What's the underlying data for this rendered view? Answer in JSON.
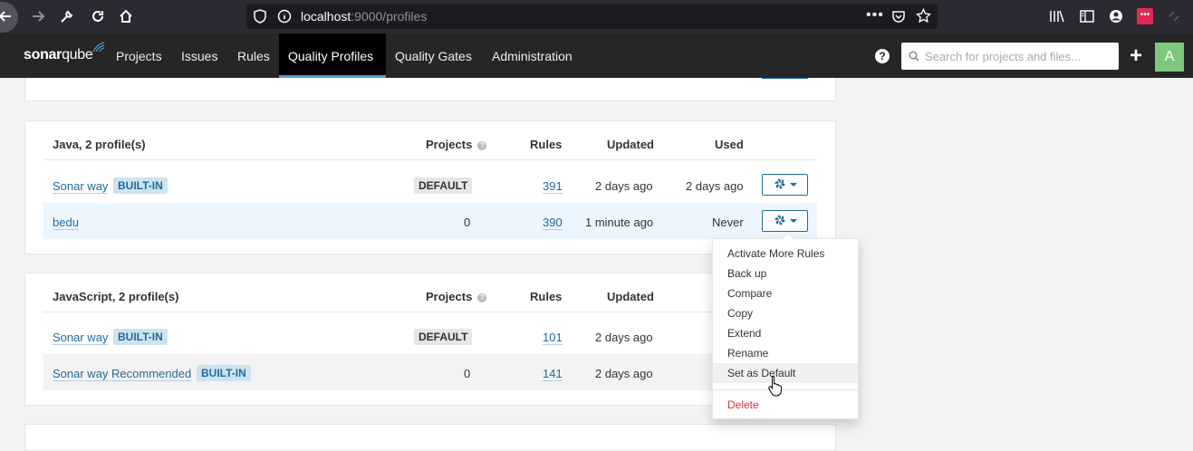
{
  "browser": {
    "url_host": "localhost",
    "url_rest": ":9000/profiles"
  },
  "nav": {
    "logo_bold": "sonar",
    "logo_light": "qube",
    "items": [
      "Projects",
      "Issues",
      "Rules",
      "Quality Profiles",
      "Quality Gates",
      "Administration"
    ],
    "active_index": 3,
    "search_placeholder": "Search for projects and files...",
    "help": "?",
    "add": "+",
    "avatar_letter": "A",
    "accent_color": "#4b9fd5"
  },
  "columns": {
    "projects": "Projects",
    "rules": "Rules",
    "updated": "Updated",
    "used": "Used"
  },
  "java": {
    "title": "Java, 2 profile(s)",
    "rows": [
      {
        "name": "Sonar way",
        "badge": "BUILT-IN",
        "projects_badge": "DEFAULT",
        "rules": "391",
        "updated": "2 days ago",
        "used": "2 days ago"
      },
      {
        "name": "bedu",
        "projects": "0",
        "rules": "390",
        "updated": "1 minute ago",
        "used": "Never"
      }
    ]
  },
  "javascript": {
    "title": "JavaScript, 2 profile(s)",
    "rows": [
      {
        "name": "Sonar way",
        "badge": "BUILT-IN",
        "projects_badge": "DEFAULT",
        "rules": "101",
        "updated": "2 days ago"
      },
      {
        "name": "Sonar way Recommended",
        "badge": "BUILT-IN",
        "projects": "0",
        "rules": "141",
        "updated": "2 days ago"
      }
    ]
  },
  "dropdown": {
    "items": [
      "Activate More Rules",
      "Back up",
      "Compare",
      "Copy",
      "Extend",
      "Rename",
      "Set as Default"
    ],
    "hover_index": 6,
    "delete": "Delete"
  }
}
